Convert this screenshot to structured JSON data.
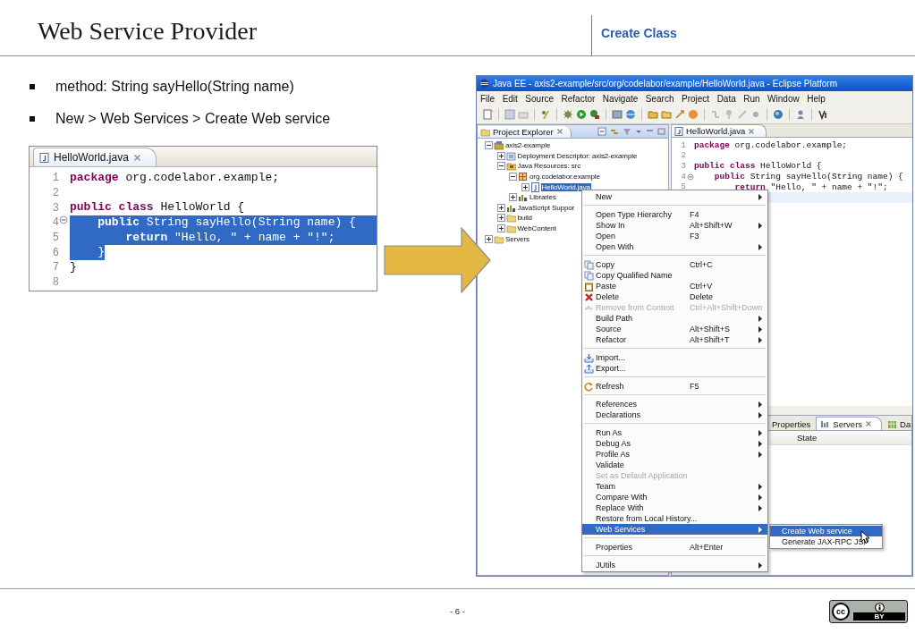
{
  "header": {
    "title": "Web Service Provider",
    "section": "Create Class"
  },
  "bullets": [
    "method: String sayHello(String name)",
    "New > Web Services > Create Web service"
  ],
  "snippet": {
    "tab": "HelloWorld.java",
    "lines": [
      {
        "number": "1",
        "code": "**package** org.codelabor.example;",
        "selected": false,
        "foldable": false
      },
      {
        "number": "2",
        "selected": false,
        "foldable": false
      },
      {
        "number": "3",
        "code": "**public class** HelloWorld {",
        "selected": false,
        "foldable": false
      },
      {
        "number": "4",
        "code": "    **public** String sayHello(String name) {",
        "selected": true,
        "through_end": true,
        "foldable": true
      },
      {
        "number": "5",
        "code": "        **return** \"Hello, \" + name + \"!\";",
        "selected": true,
        "through_end": true,
        "foldable": false
      },
      {
        "number": "6",
        "code": "    }",
        "selected": true,
        "through_end": false,
        "foldable": false
      },
      {
        "number": "7",
        "code": "}",
        "selected": false,
        "foldable": false
      },
      {
        "number": "8",
        "selected": false,
        "foldable": false
      }
    ]
  },
  "eclipse": {
    "title": "Java EE - axis2-example/src/org/codelabor/example/HelloWorld.java - Eclipse Platform",
    "menus": [
      "File",
      "Edit",
      "Source",
      "Refactor",
      "Navigate",
      "Search",
      "Project",
      "Data",
      "Run",
      "Window",
      "Help"
    ],
    "explorer": {
      "tab": "Project Explorer",
      "tree": [
        {
          "label": "axis2-example",
          "kind": "project",
          "expanded": true,
          "selected": false,
          "children": [
            {
              "label": "Deployment Descriptor: axis2-example",
              "kind": "descriptor",
              "expanded": false,
              "selected": false
            },
            {
              "label": "Java Resources: src",
              "kind": "source-folder",
              "expanded": true,
              "selected": false,
              "children": [
                {
                  "label": "org.codelabor.example",
                  "kind": "package",
                  "expanded": true,
                  "selected": false,
                  "children": [
                    {
                      "label": "HelloWorld.java",
                      "kind": "java-file",
                      "expanded": false,
                      "selected": true
                    }
                  ]
                },
                {
                  "label": "Libraries",
                  "kind": "library",
                  "expanded": false,
                  "selected": false
                }
              ]
            },
            {
              "label": "JavaScript Suppor",
              "kind": "library",
              "expanded": false,
              "selected": false
            },
            {
              "label": "build",
              "kind": "folder",
              "expanded": false,
              "selected": false
            },
            {
              "label": "WebContent",
              "kind": "folder",
              "expanded": false,
              "selected": false
            }
          ]
        },
        {
          "label": "Servers",
          "kind": "folder",
          "expanded": false,
          "selected": false
        }
      ]
    },
    "editor": {
      "tab": "HelloWorld.java",
      "lines": [
        {
          "number": "1",
          "code": "**package** org.codelabor.example;",
          "foldable": false,
          "current": false
        },
        {
          "number": "2",
          "foldable": false,
          "current": false
        },
        {
          "number": "3",
          "code": "**public class** HelloWorld {",
          "foldable": false,
          "current": false
        },
        {
          "number": "4",
          "code": "    **public** String sayHello(String name) {",
          "foldable": true,
          "current": false
        },
        {
          "number": "5",
          "code": "        **return** \"Hello, \" + name + \"!\";",
          "foldable": false,
          "current": false
        },
        {
          "foldable": false,
          "current": true
        }
      ]
    },
    "bottom_panel": {
      "tabs": [
        {
          "label": "Properties",
          "selected": false
        },
        {
          "label": "Servers",
          "selected": true
        },
        {
          "label": "Da",
          "selected": false
        }
      ],
      "columns": [
        "State"
      ]
    },
    "context_menu": {
      "items": [
        {
          "kind": "command",
          "label": "New",
          "submenu": true,
          "disabled": false,
          "selected": false
        },
        {
          "kind": "separator"
        },
        {
          "kind": "command",
          "label": "Open Type Hierarchy",
          "shortcut": "F4",
          "submenu": false,
          "disabled": false,
          "selected": false
        },
        {
          "kind": "command",
          "label": "Show In",
          "shortcut": "Alt+Shift+W",
          "submenu": true,
          "disabled": false,
          "selected": false
        },
        {
          "kind": "command",
          "label": "Open",
          "shortcut": "F3",
          "submenu": false,
          "disabled": false,
          "selected": false
        },
        {
          "kind": "command",
          "label": "Open With",
          "submenu": true,
          "disabled": false,
          "selected": false
        },
        {
          "kind": "separator"
        },
        {
          "kind": "command",
          "label": "Copy",
          "shortcut": "Ctrl+C",
          "submenu": false,
          "disabled": false,
          "selected": false
        },
        {
          "kind": "command",
          "label": "Copy Qualified Name",
          "submenu": false,
          "disabled": false,
          "selected": false
        },
        {
          "kind": "command",
          "label": "Paste",
          "shortcut": "Ctrl+V",
          "submenu": false,
          "disabled": false,
          "selected": false
        },
        {
          "kind": "command",
          "label": "Delete",
          "shortcut": "Delete",
          "submenu": false,
          "disabled": false,
          "selected": false
        },
        {
          "kind": "command",
          "label": "Remove from Context",
          "shortcut": "Ctrl+Alt+Shift+Down",
          "submenu": false,
          "disabled": true,
          "selected": false
        },
        {
          "kind": "command",
          "label": "Build Path",
          "submenu": true,
          "disabled": false,
          "selected": false
        },
        {
          "kind": "command",
          "label": "Source",
          "shortcut": "Alt+Shift+S",
          "submenu": true,
          "disabled": false,
          "selected": false
        },
        {
          "kind": "command",
          "label": "Refactor",
          "shortcut": "Alt+Shift+T",
          "submenu": true,
          "disabled": false,
          "selected": false
        },
        {
          "kind": "separator"
        },
        {
          "kind": "command",
          "label": "Import...",
          "submenu": false,
          "disabled": false,
          "selected": false
        },
        {
          "kind": "command",
          "label": "Export...",
          "submenu": false,
          "disabled": false,
          "selected": false
        },
        {
          "kind": "separator"
        },
        {
          "kind": "command",
          "label": "Refresh",
          "shortcut": "F5",
          "submenu": false,
          "disabled": false,
          "selected": false
        },
        {
          "kind": "separator"
        },
        {
          "kind": "command",
          "label": "References",
          "submenu": true,
          "disabled": false,
          "selected": false
        },
        {
          "kind": "command",
          "label": "Declarations",
          "submenu": true,
          "disabled": false,
          "selected": false
        },
        {
          "kind": "separator"
        },
        {
          "kind": "command",
          "label": "Run As",
          "submenu": true,
          "disabled": false,
          "selected": false
        },
        {
          "kind": "command",
          "label": "Debug As",
          "submenu": true,
          "disabled": false,
          "selected": false
        },
        {
          "kind": "command",
          "label": "Profile As",
          "submenu": true,
          "disabled": false,
          "selected": false
        },
        {
          "kind": "command",
          "label": "Validate",
          "submenu": false,
          "disabled": false,
          "selected": false
        },
        {
          "kind": "command",
          "label": "Set as Default Application",
          "submenu": false,
          "disabled": true,
          "selected": false
        },
        {
          "kind": "command",
          "label": "Team",
          "submenu": true,
          "disabled": false,
          "selected": false
        },
        {
          "kind": "command",
          "label": "Compare With",
          "submenu": true,
          "disabled": false,
          "selected": false
        },
        {
          "kind": "command",
          "label": "Replace With",
          "submenu": true,
          "disabled": false,
          "selected": false
        },
        {
          "kind": "command",
          "label": "Restore from Local History...",
          "submenu": false,
          "disabled": false,
          "selected": false
        },
        {
          "kind": "command",
          "label": "Web Services",
          "submenu": true,
          "disabled": false,
          "selected": true
        },
        {
          "kind": "separator"
        },
        {
          "kind": "command",
          "label": "Properties",
          "shortcut": "Alt+Enter",
          "submenu": false,
          "disabled": false,
          "selected": false
        },
        {
          "kind": "separator"
        },
        {
          "kind": "command",
          "label": "JUtils",
          "submenu": true,
          "disabled": false,
          "selected": false
        }
      ]
    },
    "submenu": {
      "items": [
        {
          "label": "Create Web service",
          "selected": true
        },
        {
          "label": "Generate JAX-RPC JSP",
          "selected": false
        }
      ]
    }
  },
  "footer": {
    "page": "- 6 -",
    "license": {
      "mark": "cc",
      "label": "BY"
    }
  }
}
